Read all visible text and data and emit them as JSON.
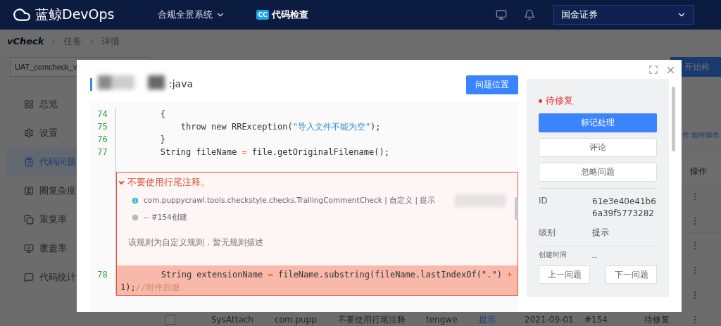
{
  "topbar": {
    "brand": "蓝鲸DevOps",
    "nav_item": "合规全景系统",
    "app_badge": "CC",
    "app_name": "代码检查",
    "org_select": "国金证券"
  },
  "breadcrumb": {
    "logo": "vCheck",
    "items": [
      "任务",
      "详情"
    ]
  },
  "toolbar": {
    "task_field": "UAT_comcheck_v",
    "start_button": "开始检"
  },
  "sidebar": {
    "items": [
      {
        "label": "总览",
        "selected": false
      },
      {
        "label": "设置",
        "selected": false
      },
      {
        "label": "代码问题",
        "selected": true
      },
      {
        "label": "圈复杂度",
        "selected": false
      },
      {
        "label": "重复率",
        "selected": false
      },
      {
        "label": "覆盖率",
        "selected": false
      },
      {
        "label": "代码统计",
        "selected": false
      }
    ]
  },
  "hint_link": "作 如何操作",
  "table": {
    "ops_header": "操作",
    "rows": [
      {
        "kind": "covered"
      },
      {
        "kind": "covered"
      },
      {
        "kind": "covered"
      },
      {
        "kind": "covered"
      },
      {
        "kind": "covered"
      },
      {
        "kind": "full",
        "checked": false,
        "cells": [
          "SysAttach",
          "com.pupp",
          "不要使用行尾注释",
          "tengwe",
          "提示",
          "2021-09-01",
          "#154",
          "待修复"
        ]
      }
    ]
  },
  "dialog": {
    "file_name": ":java",
    "locate_button": "问题位置",
    "code_before": [
      {
        "number": "74",
        "tokens": [
          {
            "kind": "plain",
            "text": "        {"
          }
        ]
      },
      {
        "number": "75",
        "tokens": [
          {
            "kind": "plain",
            "text": "            throw new RRException("
          },
          {
            "kind": "str",
            "text": "\"导入文件不能为空\""
          },
          {
            "kind": "plain",
            "text": ");"
          }
        ]
      },
      {
        "number": "76",
        "tokens": [
          {
            "kind": "plain",
            "text": "        }"
          }
        ]
      },
      {
        "number": "77",
        "tokens": [
          {
            "kind": "plain",
            "text": "        String fileName "
          },
          {
            "kind": "op",
            "text": "="
          },
          {
            "kind": "plain",
            "text": " file.getOriginalFilename();"
          }
        ]
      }
    ],
    "issue": {
      "title": "不要使用行尾注释。",
      "rule": "com.puppycrawl.tools.checkstyle.checks.TrailingCommentCheck | 自定义 | 提示",
      "creator": "-- #154创建",
      "description": "该规则为自定义规则，暂无规则描述"
    },
    "flagged_line": {
      "number": "78",
      "tokens": [
        {
          "kind": "plain",
          "text": "        String extensionName "
        },
        {
          "kind": "op",
          "text": "="
        },
        {
          "kind": "plain",
          "text": " fileName.substring(fileName.lastIndexOf("
        },
        {
          "kind": "plain",
          "text": "\".\""
        },
        {
          "kind": "plain",
          "text": ") "
        },
        {
          "kind": "op",
          "text": "+"
        },
        {
          "kind": "plain",
          "text": " 1);"
        },
        {
          "kind": "comment",
          "text": "//附件后缀"
        }
      ]
    },
    "side": {
      "status": "待修复",
      "primary_button": "标记处理",
      "buttons": [
        "评论",
        "忽略问题"
      ],
      "fields": [
        {
          "label": "ID",
          "value": "61e3e40e41b66a39f5773282"
        },
        {
          "label": "级别",
          "value": "提示"
        }
      ],
      "created_label": "创建时间",
      "created_value": "--",
      "prev_button": "上一问题",
      "next_button": "下一问题"
    }
  }
}
